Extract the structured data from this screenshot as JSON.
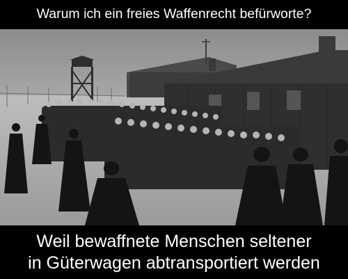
{
  "meme": {
    "top_text": "Warum ich ein freies Waffenrecht befürworte?",
    "bottom_line_1": "Weil bewaffnete Menschen seltener",
    "bottom_line_2": "in Güterwagen abtransportiert werden"
  },
  "colors": {
    "caption_background": "#000000",
    "caption_text": "#ffffff"
  }
}
